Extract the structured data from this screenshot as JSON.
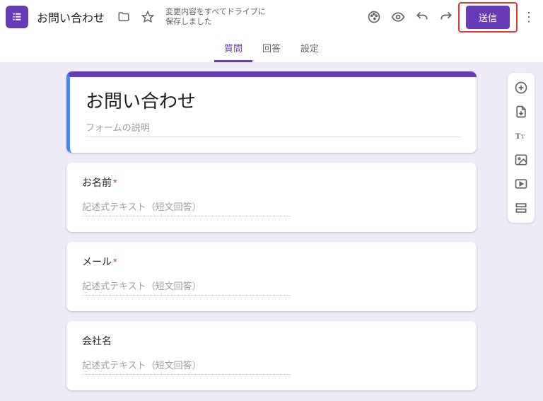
{
  "header": {
    "doc_title": "お問い合わせ",
    "save_status_line1": "変更内容をすべてドライブに",
    "save_status_line2": "保存しました",
    "send_label": "送信"
  },
  "tabs": {
    "questions": "質問",
    "responses": "回答",
    "settings": "設定"
  },
  "form": {
    "title": "お問い合わせ",
    "description_placeholder": "フォームの説明",
    "short_answer_placeholder": "記述式テキスト（短文回答）"
  },
  "questions": [
    {
      "label": "お名前",
      "required": true
    },
    {
      "label": "メール",
      "required": true
    },
    {
      "label": "会社名",
      "required": false
    }
  ]
}
